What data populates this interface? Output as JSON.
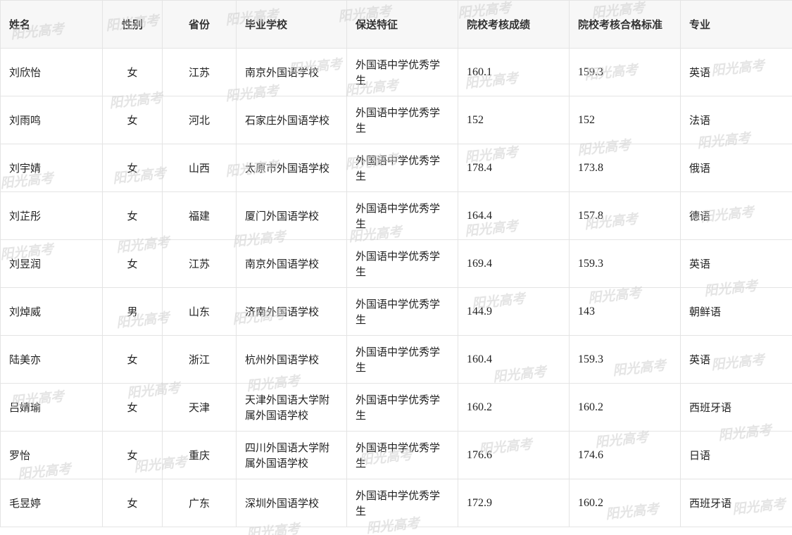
{
  "table": {
    "headers": [
      "姓名",
      "性别",
      "省份",
      "毕业学校",
      "保送特征",
      "院校考核成绩",
      "院校考核合格标准",
      "专业"
    ],
    "rows": [
      [
        "刘欣怡",
        "女",
        "江苏",
        "南京外国语学校",
        "外国语中学优秀学生",
        "160.1",
        "159.3",
        "英语"
      ],
      [
        "刘雨鸣",
        "女",
        "河北",
        "石家庄外国语学校",
        "外国语中学优秀学生",
        "152",
        "152",
        "法语"
      ],
      [
        "刘宇婧",
        "女",
        "山西",
        "太原市外国语学校",
        "外国语中学优秀学生",
        "178.4",
        "173.8",
        "俄语"
      ],
      [
        "刘芷彤",
        "女",
        "福建",
        "厦门外国语学校",
        "外国语中学优秀学生",
        "164.4",
        "157.8",
        "德语"
      ],
      [
        "刘昱润",
        "女",
        "江苏",
        "南京外国语学校",
        "外国语中学优秀学生",
        "169.4",
        "159.3",
        "英语"
      ],
      [
        "刘焯威",
        "男",
        "山东",
        "济南外国语学校",
        "外国语中学优秀学生",
        "144.9",
        "143",
        "朝鲜语"
      ],
      [
        "陆美亦",
        "女",
        "浙江",
        "杭州外国语学校",
        "外国语中学优秀学生",
        "160.4",
        "159.3",
        "英语"
      ],
      [
        "吕婧瑜",
        "女",
        "天津",
        "天津外国语大学附属外国语学校",
        "外国语中学优秀学生",
        "160.2",
        "160.2",
        "西班牙语"
      ],
      [
        "罗怡",
        "女",
        "重庆",
        "四川外国语大学附属外国语学校",
        "外国语中学优秀学生",
        "176.6",
        "174.6",
        "日语"
      ],
      [
        "毛昱婷",
        "女",
        "广东",
        "深圳外国语学校",
        "外国语中学优秀学生",
        "172.9",
        "160.2",
        "西班牙语"
      ]
    ]
  },
  "watermark": {
    "text": "阳光高考"
  }
}
